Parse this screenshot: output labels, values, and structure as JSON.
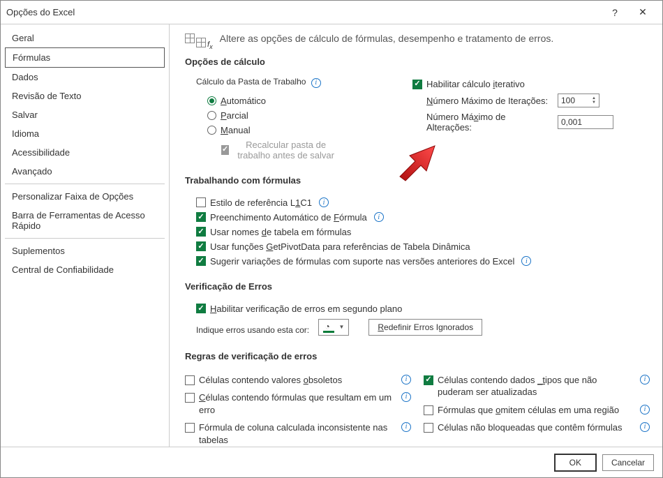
{
  "window": {
    "title": "Opções do Excel"
  },
  "sidebar": {
    "items": [
      {
        "label": "Geral"
      },
      {
        "label": "Fórmulas"
      },
      {
        "label": "Dados"
      },
      {
        "label": "Revisão de Texto"
      },
      {
        "label": "Salvar"
      },
      {
        "label": "Idioma"
      },
      {
        "label": "Acessibilidade"
      },
      {
        "label": "Avançado"
      },
      {
        "label": "Personalizar Faixa de Opções"
      },
      {
        "label": "Barra de Ferramentas de Acesso Rápido"
      },
      {
        "label": "Suplementos"
      },
      {
        "label": "Central de Confiabilidade"
      }
    ]
  },
  "header": {
    "desc": "Altere as opções de cálculo de fórmulas, desempenho e tratamento de erros."
  },
  "calc": {
    "section": "Opções de cálculo",
    "workbook_label": "Cálculo da Pasta de Trabalho",
    "auto": "Automático",
    "partial": "Parcial",
    "manual": "Manual",
    "recalc_before_save": "Recalcular pasta de trabalho antes de salvar",
    "iter_enable": "Habilitar cálculo iterativo",
    "iter_max_label": "Número Máximo de Iterações:",
    "iter_max_value": "100",
    "iter_change_label": "Número Máximo de Alterações:",
    "iter_change_value": "0,001"
  },
  "formulas": {
    "section": "Trabalhando com fórmulas",
    "r1c1": "Estilo de referência L1C1",
    "autocomplete": "Preenchimento Automático de Fórmula",
    "table_names": "Usar nomes de tabela em fórmulas",
    "getpivot": "Usar funções GetPivotData para referências de Tabela Dinâmica",
    "suggest": "Sugerir variações de fórmulas com suporte nas versões anteriores do Excel"
  },
  "error_check": {
    "section": "Verificação de Erros",
    "bg_enable": "Habilitar verificação de erros em segundo plano",
    "color_label": "Indique erros usando esta cor:",
    "reset_btn": "Redefinir Erros Ignorados"
  },
  "error_rules": {
    "section": "Regras de verificação de erros",
    "obsolete": "Células contendo valores obsoletos",
    "result_err": "Células contendo fórmulas que resultam em um erro",
    "calc_col": "Fórmula de coluna calculada inconsistente nas tabelas",
    "stale_types": "Células contendo dados _tipos que não puderam ser atualizadas",
    "omit": "Fórmulas que omitem células em uma região",
    "unlocked": "Células não bloqueadas que contêm fórmulas"
  },
  "footer": {
    "ok": "OK",
    "cancel": "Cancelar"
  }
}
